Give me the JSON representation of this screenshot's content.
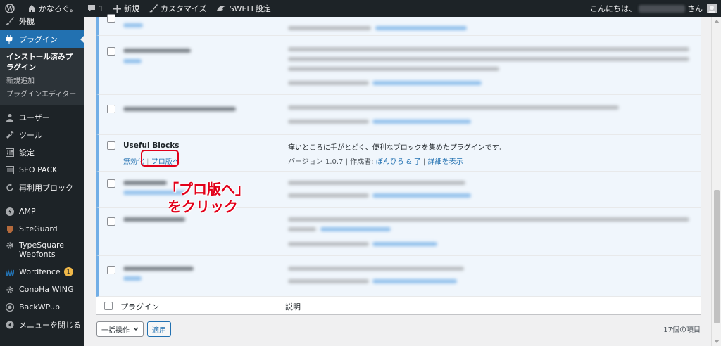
{
  "adminbar": {
    "site_name": "かなろぐ。",
    "comments_count": "1",
    "new_label": "新規",
    "customize_label": "カスタマイズ",
    "swell_label": "SWELL設定",
    "greeting": "こんにちは、",
    "greeting_suffix": "さん"
  },
  "sidebar": {
    "appearance": "外観",
    "plugins": "プラグイン",
    "sub_installed": "インストール済みプラグイン",
    "sub_add_new": "新規追加",
    "sub_editor": "プラグインエディター",
    "users": "ユーザー",
    "tools": "ツール",
    "settings": "設定",
    "seo_pack": "SEO PACK",
    "reusable": "再利用ブロック",
    "amp": "AMP",
    "siteguard": "SiteGuard",
    "typesquare": "TypeSquare Webfonts",
    "wordfence": "Wordfence",
    "wordfence_badge": "1",
    "conoha": "ConoHa WING",
    "backwpup": "BackWPup",
    "collapse": "メニューを閉じる"
  },
  "plugin": {
    "name": "Useful Blocks",
    "action_deactivate": "無効化",
    "action_pro": "プロ版へ",
    "description": "痒いところに手がとどく、便利なブロックを集めたプラグインです。",
    "version_text": "バージョン 1.0.7 | 作成者: ",
    "author": "ぽんひろ & 了",
    "separator": " | ",
    "details_link": "詳細を表示"
  },
  "annotation": {
    "line1": "「プロ版へ」",
    "line2": "をクリック"
  },
  "table_footer": {
    "col_plugin": "プラグイン",
    "col_description": "説明"
  },
  "bulk": {
    "select_label": "一括操作",
    "apply_label": "適用",
    "item_count": "17個の項目"
  },
  "colors": {
    "accent": "#2271b1",
    "annotation": "#e2001a",
    "admin_dark": "#1d2327"
  }
}
